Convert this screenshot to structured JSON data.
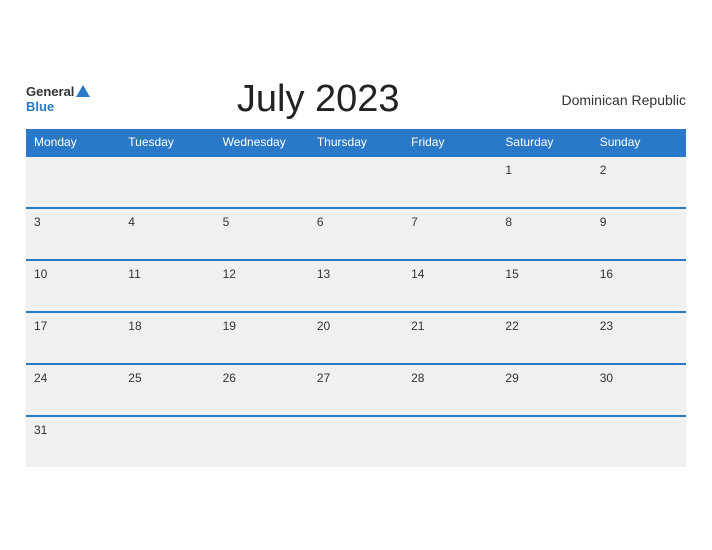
{
  "header": {
    "logo_general": "General",
    "logo_blue": "Blue",
    "month_title": "July 2023",
    "region": "Dominican Republic"
  },
  "days_of_week": [
    "Monday",
    "Tuesday",
    "Wednesday",
    "Thursday",
    "Friday",
    "Saturday",
    "Sunday"
  ],
  "weeks": [
    [
      "",
      "",
      "",
      "",
      "",
      "1",
      "2"
    ],
    [
      "3",
      "4",
      "5",
      "6",
      "7",
      "8",
      "9"
    ],
    [
      "10",
      "11",
      "12",
      "13",
      "14",
      "15",
      "16"
    ],
    [
      "17",
      "18",
      "19",
      "20",
      "21",
      "22",
      "23"
    ],
    [
      "24",
      "25",
      "26",
      "27",
      "28",
      "29",
      "30"
    ],
    [
      "31",
      "",
      "",
      "",
      "",
      "",
      ""
    ]
  ]
}
